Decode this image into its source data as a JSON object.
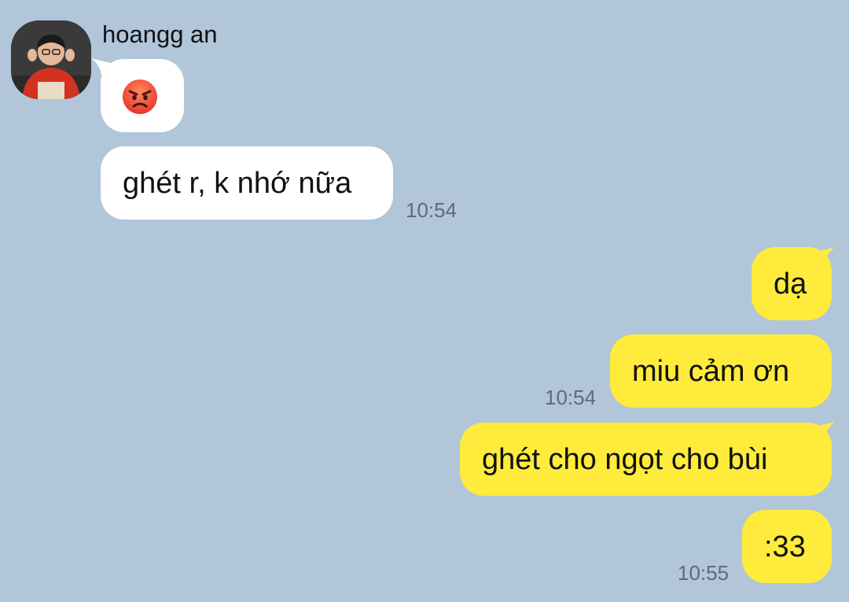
{
  "contact": {
    "name": "hoangg an",
    "avatar_icon": "profile-photo-icon"
  },
  "messages": {
    "in_emoji": {
      "icon": "angry-face-emoji"
    },
    "in_text": "ghét r, k nhớ nữa",
    "in_time": "10:54",
    "out_1": "dạ",
    "out_2": "miu cảm ơn",
    "out_2_time": "10:54",
    "out_3": "ghét cho ngọt cho bùi",
    "out_4": ":33",
    "out_4_time": "10:55"
  },
  "colors": {
    "background": "#b1c6d9",
    "incoming_bubble": "#ffffff",
    "outgoing_bubble": "#ffeb3b",
    "timestamp": "#5f6b76"
  }
}
